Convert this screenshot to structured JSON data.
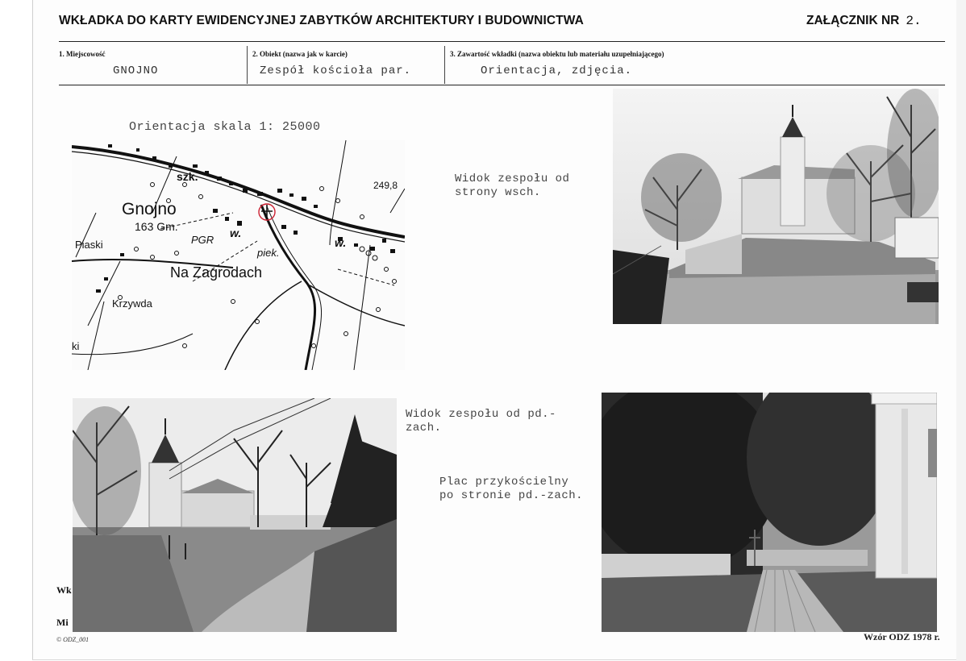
{
  "header": {
    "title": "WKŁADKA DO KARTY EWIDENCYJNEJ ZABYTKÓW ARCHITEKTURY I BUDOWNICTWA",
    "annex_label": "ZAŁĄCZNIK NR",
    "annex_number": "2."
  },
  "fields": [
    {
      "label": "1. Miejscowość",
      "value": "GNOJNO"
    },
    {
      "label": "2. Obiekt (nazwa jak w karcie)",
      "value": "Zespół kościoła par."
    },
    {
      "label": "3. Zawartość wkładki (nazwa obiektu lub materiału uzupełniającego)",
      "value": "Orientacja, zdjęcia."
    }
  ],
  "map": {
    "caption": "Orientacja skala 1: 25000",
    "labels": {
      "town": "Gnojno",
      "elev_town": "163 Gm.",
      "szk": "szk.",
      "elev_ne": "249,8",
      "pgr": "PGR",
      "w1": "w.",
      "w2": "w.",
      "piek": "piek.",
      "piaski": "Piaski",
      "zagrodach": "Na Zagrodach",
      "krzywda": "Krzywda",
      "edge_k": "ki"
    }
  },
  "captions": {
    "photo1": [
      "Widok zespołu od",
      "strony wsch."
    ],
    "photo2": [
      "Widok zespołu od pd.-",
      "zach."
    ],
    "photo3": [
      "Plac przykościelny",
      "po stronie pd.-zach."
    ]
  },
  "underlying_form": {
    "frag1": "Wk",
    "frag2": "Mi"
  },
  "footer": {
    "code": "© ODZ_001",
    "pattern": "Wzór ODZ 1978 r."
  }
}
